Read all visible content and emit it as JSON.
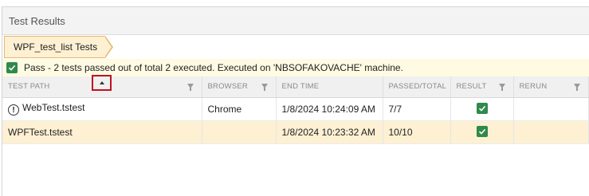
{
  "panel": {
    "title": "Test Results"
  },
  "breadcrumb": {
    "label": "WPF_test_list Tests"
  },
  "status": {
    "text": "Pass - 2 tests passed out of total 2 executed. Executed on 'NBSOFAKOVACHE' machine."
  },
  "table": {
    "columns": [
      "TEST PATH",
      "BROWSER",
      "END TIME",
      "PASSED/TOTAL",
      "RESULT",
      "RERUN"
    ],
    "rows": [
      {
        "test_path": "WebTest.tstest",
        "browser": "Chrome",
        "end_time": "1/8/2024 10:24:09 AM",
        "passed_total": "7/7",
        "result": "pass-check",
        "rerun": "",
        "icon": "warning-circle-icon"
      },
      {
        "test_path": "WPFTest.tstest",
        "browser": "",
        "end_time": "1/8/2024 10:23:32 AM",
        "passed_total": "10/10",
        "result": "pass-check",
        "rerun": ""
      }
    ]
  },
  "colors": {
    "pass_green": "#2f8a4b",
    "selected_row": "#fdf0d3",
    "highlight_red": "#c0111f",
    "status_bg": "#fffbe3"
  }
}
